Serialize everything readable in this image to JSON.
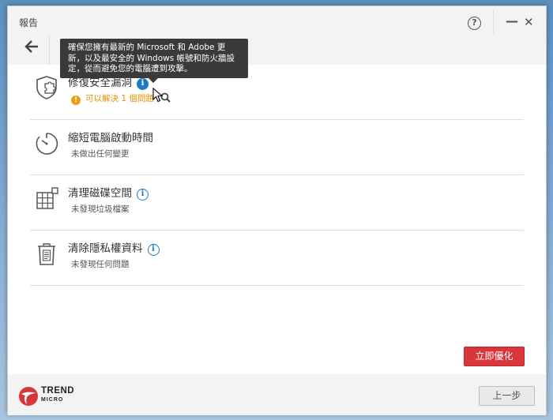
{
  "window": {
    "title": "報告"
  },
  "tooltip": {
    "line1": "確保您擁有最新的 Microsoft 和 Adobe 更",
    "line2": "新，以及最安全的 Windows 帳號和防火牆設",
    "line3": "定，從而避免您的電腦遭到攻擊。"
  },
  "items": [
    {
      "name": "修復安全漏洞",
      "status": "可以解決 1 個問題",
      "status_type": "warning"
    },
    {
      "name": "縮短電腦啟動時間",
      "status": "未做出任何變更"
    },
    {
      "name": "清理磁碟空間",
      "status": "未發現垃圾檔案"
    },
    {
      "name": "清除隱私權資料",
      "status": "未發現任何問題"
    }
  ],
  "buttons": {
    "optimize": "立即優化",
    "previous": "上一步"
  },
  "logo": {
    "line1": "TREND",
    "line2": "MICRO"
  },
  "colors": {
    "accent": "#d9363b",
    "info": "#1f7bc0",
    "warning": "#e9a10b"
  }
}
